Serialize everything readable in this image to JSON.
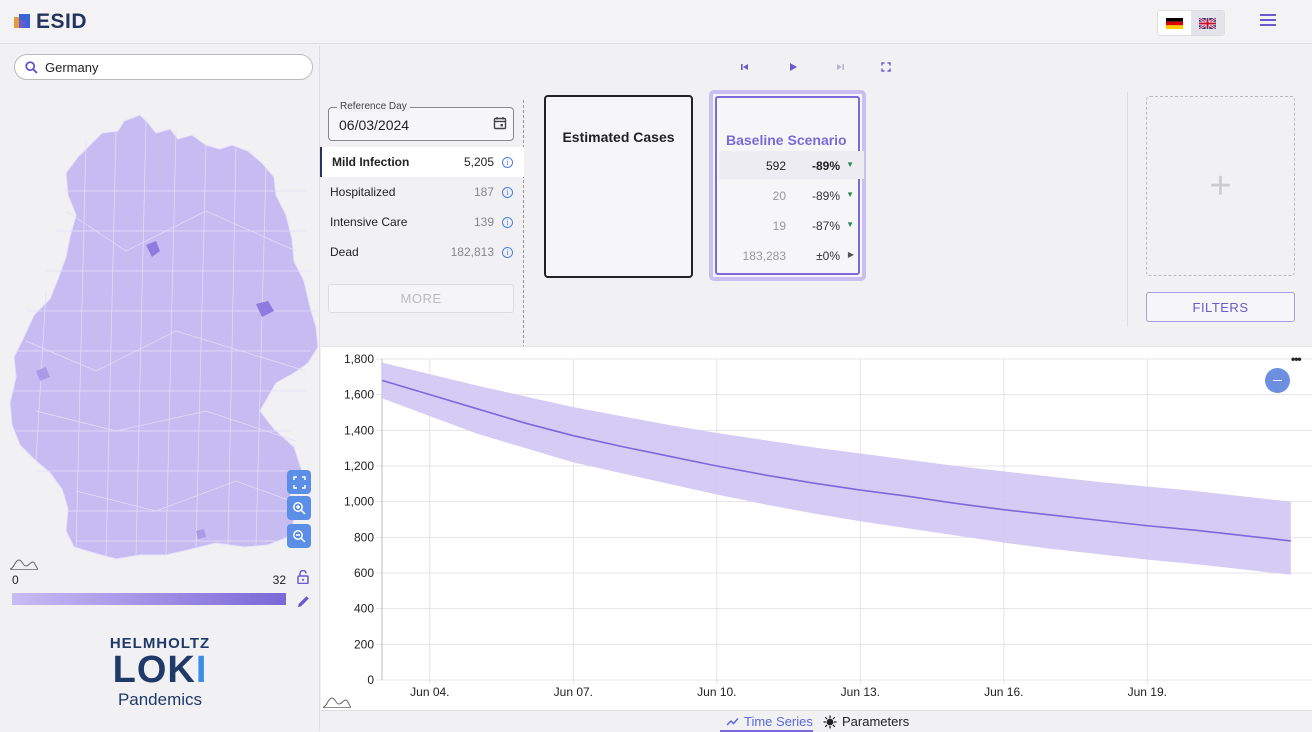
{
  "app": {
    "title": "ESID"
  },
  "languages": [
    "DE",
    "EN"
  ],
  "search": {
    "value": "Germany",
    "placeholder": "Search"
  },
  "map": {
    "legend_min": "0",
    "legend_max": "32"
  },
  "helmholtz": {
    "line1": "HELMHOLTZ",
    "line2": "LOKI",
    "line3": "Pandemics"
  },
  "reference_day": {
    "label": "Reference Day",
    "value": "06/03/2024"
  },
  "compartments": [
    {
      "name": "Mild Infection",
      "value": "5,205"
    },
    {
      "name": "Hospitalized",
      "value": "187"
    },
    {
      "name": "Intensive Care",
      "value": "139"
    },
    {
      "name": "Dead",
      "value": "182,813"
    }
  ],
  "more_label": "MORE",
  "estimated_card": {
    "title": "Estimated Cases"
  },
  "baseline_card": {
    "title": "Baseline Scenario",
    "rows": [
      {
        "value": "592",
        "pct": "-89%"
      },
      {
        "value": "20",
        "pct": "-89%"
      },
      {
        "value": "19",
        "pct": "-87%"
      },
      {
        "value": "183,283",
        "pct": "±0%"
      }
    ]
  },
  "filters_label": "FILTERS",
  "tabs": [
    {
      "label": "Time Series"
    },
    {
      "label": "Parameters"
    }
  ],
  "colors": {
    "accent": "#7c6ad8",
    "brand": "#25345e",
    "band": "#cfc6f4",
    "line": "#7c6ad8"
  },
  "chart_data": {
    "type": "line",
    "x_ticks": [
      "Jun 04.",
      "Jun 07.",
      "Jun 10.",
      "Jun 13.",
      "Jun 16.",
      "Jun 19."
    ],
    "y_ticks": [
      "0",
      "200",
      "400",
      "600",
      "800",
      "1,000",
      "1,200",
      "1,400",
      "1,600",
      "1,800"
    ],
    "ylim": [
      0,
      1800
    ],
    "x": [
      "Jun 03.",
      "Jun 04.",
      "Jun 05.",
      "Jun 06.",
      "Jun 07.",
      "Jun 08.",
      "Jun 09.",
      "Jun 10.",
      "Jun 11.",
      "Jun 12.",
      "Jun 13.",
      "Jun 14.",
      "Jun 15.",
      "Jun 16.",
      "Jun 17.",
      "Jun 18.",
      "Jun 19.",
      "Jun 20.",
      "Jun 21.",
      "Jun 22."
    ],
    "series": [
      {
        "values": [
          1680,
          1600,
          1520,
          1440,
          1370,
          1310,
          1255,
          1200,
          1150,
          1105,
          1065,
          1030,
          990,
          955,
          925,
          895,
          865,
          840,
          810,
          780
        ]
      },
      {
        "values": [
          1780,
          1715,
          1650,
          1590,
          1530,
          1480,
          1430,
          1385,
          1345,
          1305,
          1270,
          1235,
          1200,
          1170,
          1140,
          1110,
          1085,
          1060,
          1030,
          1000
        ]
      },
      {
        "values": [
          1580,
          1480,
          1380,
          1300,
          1220,
          1160,
          1100,
          1040,
          985,
          935,
          890,
          850,
          810,
          770,
          735,
          705,
          675,
          650,
          620,
          590
        ]
      }
    ]
  }
}
